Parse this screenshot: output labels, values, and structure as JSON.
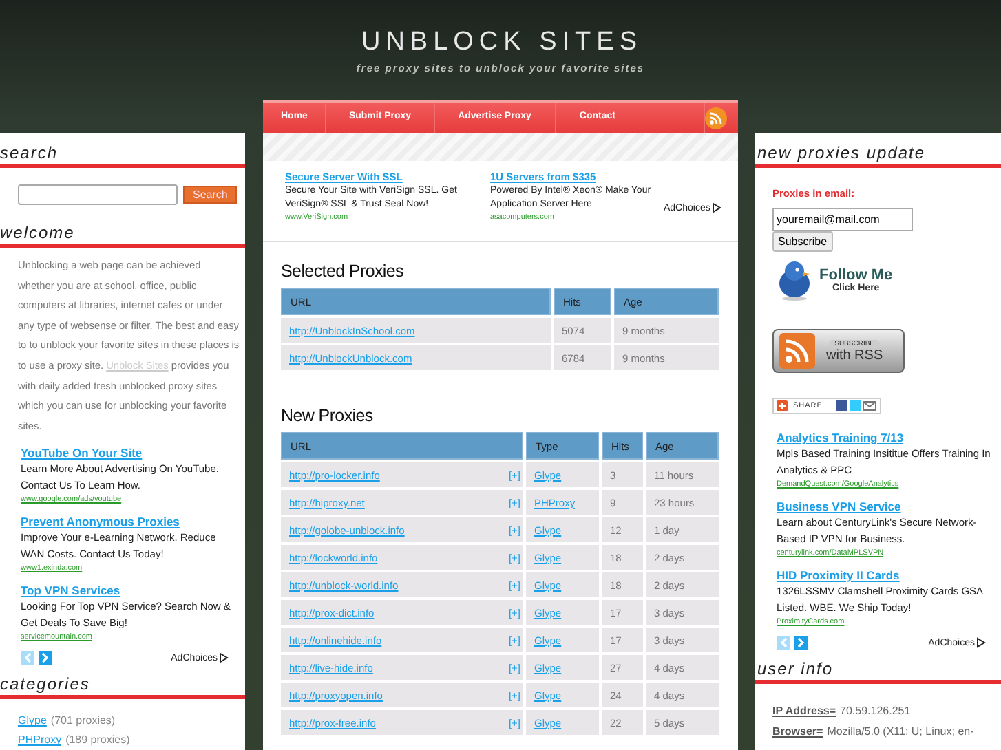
{
  "header": {
    "title": "UNBLOCK SITES",
    "tagline": "free proxy sites to unblock your favorite sites"
  },
  "left": {
    "search": {
      "heading": "search",
      "button": "Search"
    },
    "welcome": {
      "heading": "welcome",
      "text_before": "Unblocking a web page can be achieved whether you are at school, office, public computers at libraries, internet cafes or under any type of websense or filter. The best and easy to to unblock your favorite sites in these places is to use a proxy site.",
      "link": "Unblock Sites",
      "text_after": "provides you with daily added fresh unblocked proxy sites which you can use for unblocking your favorite sites."
    },
    "ads": [
      {
        "title": "YouTube On Your Site",
        "text": "Learn More About Advertising On YouTube. Contact Us To Learn How.",
        "url": "www.google.com/ads/youtube"
      },
      {
        "title": "Prevent Anonymous Proxies",
        "text": "Improve Your e-Learning Network. Reduce WAN Costs. Contact Us Today!",
        "url": "www1.exinda.com"
      },
      {
        "title": "Top VPN Services",
        "text": "Looking For Top VPN Service? Search Now & Get Deals To Save Big!",
        "url": "servicemountain.com"
      }
    ],
    "ad_pager": {
      "prev_disabled": true,
      "next_disabled": false
    },
    "adchoices": "AdChoices",
    "categories": {
      "heading": "categories",
      "items": [
        {
          "name": "Glype",
          "count": "(701 proxies)"
        },
        {
          "name": "PHProxy",
          "count": "(189 proxies)"
        }
      ]
    }
  },
  "nav": {
    "items": [
      "Home",
      "Submit Proxy",
      "Advertise Proxy",
      "Contact"
    ]
  },
  "top_ads": [
    {
      "title": "Secure Server With SSL",
      "text": "Secure Your Site with VeriSign SSL. Get VeriSign® SSL & Trust Seal Now!",
      "url": "www.VeriSign.com"
    },
    {
      "title": "1U Servers from $335",
      "text": "Powered By Intel® Xeon® Make Your Application Server Here",
      "url": "asacomputers.com"
    }
  ],
  "top_adchoices": "AdChoices",
  "selected_proxies": {
    "title": "Selected Proxies",
    "columns": [
      "URL",
      "Hits",
      "Age"
    ],
    "rows": [
      [
        "http://UnblockInSchool.com",
        "5074",
        "9 months"
      ],
      [
        "http://UnblockUnblock.com",
        "6784",
        "9 months"
      ]
    ]
  },
  "new_proxies": {
    "title": "New Proxies",
    "columns": [
      "URL",
      "Type",
      "Hits",
      "Age"
    ],
    "rows": [
      {
        "url": "http://pro-locker.info",
        "expand": "[+]",
        "type": "Glype",
        "hits": "3",
        "age": "11 hours"
      },
      {
        "url": "http://hiproxy.net",
        "expand": "[+]",
        "type": "PHProxy",
        "hits": "9",
        "age": "23 hours"
      },
      {
        "url": "http://golobe-unblock.info",
        "expand": "[+]",
        "type": "Glype",
        "hits": "12",
        "age": "1 day"
      },
      {
        "url": "http://lockworld.info",
        "expand": "[+]",
        "type": "Glype",
        "hits": "18",
        "age": "2 days"
      },
      {
        "url": "http://unblock-world.info",
        "expand": "[+]",
        "type": "Glype",
        "hits": "18",
        "age": "2 days"
      },
      {
        "url": "http://prox-dict.info",
        "expand": "[+]",
        "type": "Glype",
        "hits": "17",
        "age": "3 days"
      },
      {
        "url": "http://onlinehide.info",
        "expand": "[+]",
        "type": "Glype",
        "hits": "17",
        "age": "3 days"
      },
      {
        "url": "http://live-hide.info",
        "expand": "[+]",
        "type": "Glype",
        "hits": "27",
        "age": "4 days"
      },
      {
        "url": "http://proxyopen.info",
        "expand": "[+]",
        "type": "Glype",
        "hits": "24",
        "age": "4 days"
      },
      {
        "url": "http://prox-free.info",
        "expand": "[+]",
        "type": "Glype",
        "hits": "22",
        "age": "5 days"
      }
    ]
  },
  "right": {
    "heading": "new proxies update",
    "email_label": "Proxies in email:",
    "email_value": "youremail@mail.com",
    "subscribe_button": "Subscribe",
    "follow": {
      "title": "Follow Me",
      "subtitle": "Click Here"
    },
    "rss_badge": {
      "top": "SUBSCRIBE",
      "bottom": "with RSS"
    },
    "share": "SHARE",
    "ads": [
      {
        "title": "Analytics Training 7/13",
        "text": "Mpls Based Training Insititue Offers Training In Analytics & PPC",
        "url": "DemandQuest.com/GoogleAnalytics"
      },
      {
        "title": "Business VPN Service",
        "text": "Learn about CenturyLink's Secure Network-Based IP VPN for Business.",
        "url": "centurylink.com/DataMPLSVPN"
      },
      {
        "title": "HID Proximity II Cards",
        "text": "1326LSSMV Clamshell Proximity Cards GSA Listed. WBE. We Ship Today!",
        "url": "ProximityCards.com"
      }
    ],
    "ad_pager": {
      "prev_disabled": true,
      "next_disabled": false
    },
    "adchoices": "AdChoices",
    "user_info": {
      "heading": "user info",
      "items": [
        {
          "label": "IP Address=",
          "value": "70.59.126.251"
        },
        {
          "label": "Browser=",
          "value": "Mozilla/5.0 (X11; U; Linux; en-"
        }
      ]
    }
  }
}
